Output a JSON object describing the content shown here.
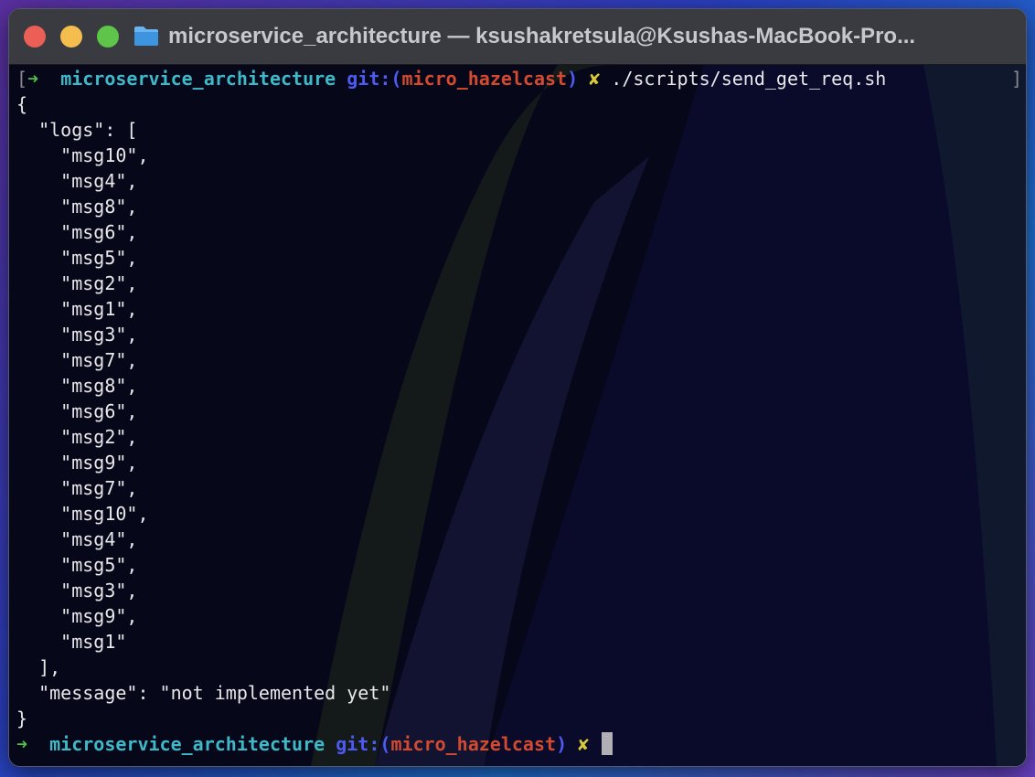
{
  "window": {
    "title": "microservice_architecture — ksushakretsula@Ksushas-MacBook-Pro..."
  },
  "colors": {
    "prompt_arrow": "#4fc24a",
    "directory": "#3fb8c8",
    "git_label": "#4d5bf0",
    "branch": "#d24a30",
    "dirty_marker": "#d8c83a",
    "terminal_bg": "#07071a"
  },
  "icons": {
    "title_folder": "folder-icon",
    "prompt": "arrow-icon",
    "dirty": "x-mark-icon"
  },
  "prompt1": {
    "open_bracket": "[",
    "arrow": "➜",
    "dir": "microservice_architecture",
    "git_open": "git:(",
    "branch": "micro_hazelcast",
    "git_close": ")",
    "dirty": "✘",
    "command": "./scripts/send_get_req.sh",
    "close_bracket": "]"
  },
  "output": [
    "{",
    "  \"logs\": [",
    "    \"msg10\",",
    "    \"msg4\",",
    "    \"msg8\",",
    "    \"msg6\",",
    "    \"msg5\",",
    "    \"msg2\",",
    "    \"msg1\",",
    "    \"msg3\",",
    "    \"msg7\",",
    "    \"msg8\",",
    "    \"msg6\",",
    "    \"msg2\",",
    "    \"msg9\",",
    "    \"msg7\",",
    "    \"msg10\",",
    "    \"msg4\",",
    "    \"msg5\",",
    "    \"msg3\",",
    "    \"msg9\",",
    "    \"msg1\"",
    "  ],",
    "  \"message\": \"not implemented yet\"",
    "}"
  ],
  "prompt2": {
    "arrow": "➜",
    "dir": "microservice_architecture",
    "git_open": "git:(",
    "branch": "micro_hazelcast",
    "git_close": ")",
    "dirty": "✘"
  }
}
